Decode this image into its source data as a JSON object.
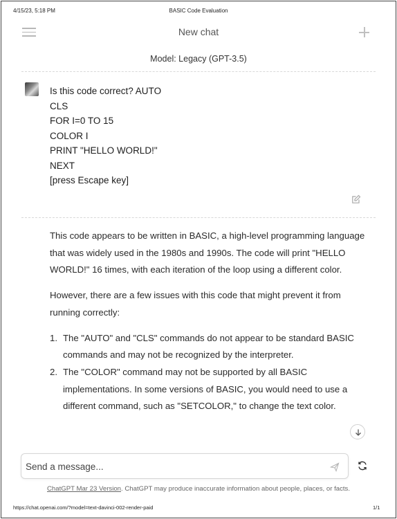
{
  "print_header": {
    "date": "4/15/23, 5:18 PM",
    "title": "BASIC Code Evaluation"
  },
  "topbar": {
    "title": "New chat",
    "menu_icon": "hamburger-menu-icon",
    "new_icon": "plus-icon"
  },
  "model": {
    "label": "Model: Legacy (GPT-3.5)"
  },
  "user_message": {
    "lines": [
      "Is this code correct? AUTO",
      "CLS",
      "FOR I=0 TO 15",
      "COLOR I",
      "PRINT \"HELLO WORLD!\"",
      "NEXT",
      "[press Escape key]"
    ]
  },
  "assistant_message": {
    "para1": "This code appears to be written in BASIC, a high-level programming language that was widely used in the 1980s and 1990s. The code will print \"HELLO WORLD!\" 16 times, with each iteration of the loop using a different color.",
    "para2": "However, there are a few issues with this code that might prevent it from running correctly:",
    "items": [
      {
        "num": "1.",
        "text": "The \"AUTO\" and \"CLS\" commands do not appear to be standard BASIC commands and may not be recognized by the interpreter."
      },
      {
        "num": "2.",
        "text": "The \"COLOR\" command may not be supported by all BASIC implementations. In some versions of BASIC, you would need to use a different command, such as \"SETCOLOR,\" to change the text color."
      }
    ]
  },
  "composer": {
    "placeholder": "Send a message...",
    "value": ""
  },
  "footer": {
    "version_link": "ChatGPT Mar 23 Version",
    "disclaimer": ". ChatGPT may produce inaccurate information about people, places, or facts."
  },
  "print_footer": {
    "url": "https://chat.openai.com/?model=text-davinci-002-render-paid",
    "page": "1/1"
  }
}
